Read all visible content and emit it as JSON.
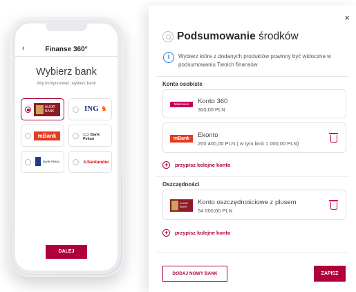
{
  "phone": {
    "back_label": "‹",
    "title": "Finanse 360°",
    "heading": "Wybierz bank",
    "subheading": "Aby kontynuować, wybierz bank",
    "banks": [
      {
        "name": "Alior Bank",
        "logo_text": "ALIOR BANK",
        "selected": true
      },
      {
        "name": "ING",
        "logo_text": "ING",
        "selected": false
      },
      {
        "name": "mBank",
        "logo_text": "mBank",
        "selected": false
      },
      {
        "name": "Bank Pekao",
        "logo_text": "Bank Pekao",
        "selected": false
      },
      {
        "name": "Bank Pekao",
        "logo_text": "Bank Pekao",
        "selected": false
      },
      {
        "name": "Santander",
        "logo_text": "Santander",
        "selected": false
      }
    ],
    "button_label": "DALEJ"
  },
  "modal": {
    "close_label": "×",
    "title_bold": "Podsumowanie",
    "title_rest": "środków",
    "info_text": "Wybierz które z dodanych produktów powinny być widoczne w podsumowaniu Twoich finansów",
    "personal_section": {
      "label": "Konta osobiste",
      "accounts": [
        {
          "bank": "Millennium",
          "logo_text": "Millennium",
          "name": "Konto 360",
          "amount": "300,00 PLN",
          "deletable": false
        },
        {
          "bank": "mBank",
          "logo_text": "mBank",
          "name": "Ekonto",
          "amount": "200 400,00 PLN ( w tym limit 1 000,00 PLN)",
          "deletable": true
        }
      ],
      "add_label": "przypisz kolejne konto"
    },
    "savings_section": {
      "label": "Oszczędności",
      "accounts": [
        {
          "bank": "Alior Bank",
          "logo_text": "ALIOR BANK",
          "name": "Konto oszczędnościowe z plusem",
          "amount": "54 000,00 PLN",
          "deletable": true
        }
      ],
      "add_label": "przypisz kolejne konto"
    },
    "add_bank_label": "DODAJ NOWY BANK",
    "save_label": "ZAPISZ"
  },
  "colors": {
    "accent": "#b0003a",
    "info": "#2a76d8",
    "mbank": "#e53b1f",
    "millennium": "#c8005a",
    "alior": "#8b1b24"
  }
}
